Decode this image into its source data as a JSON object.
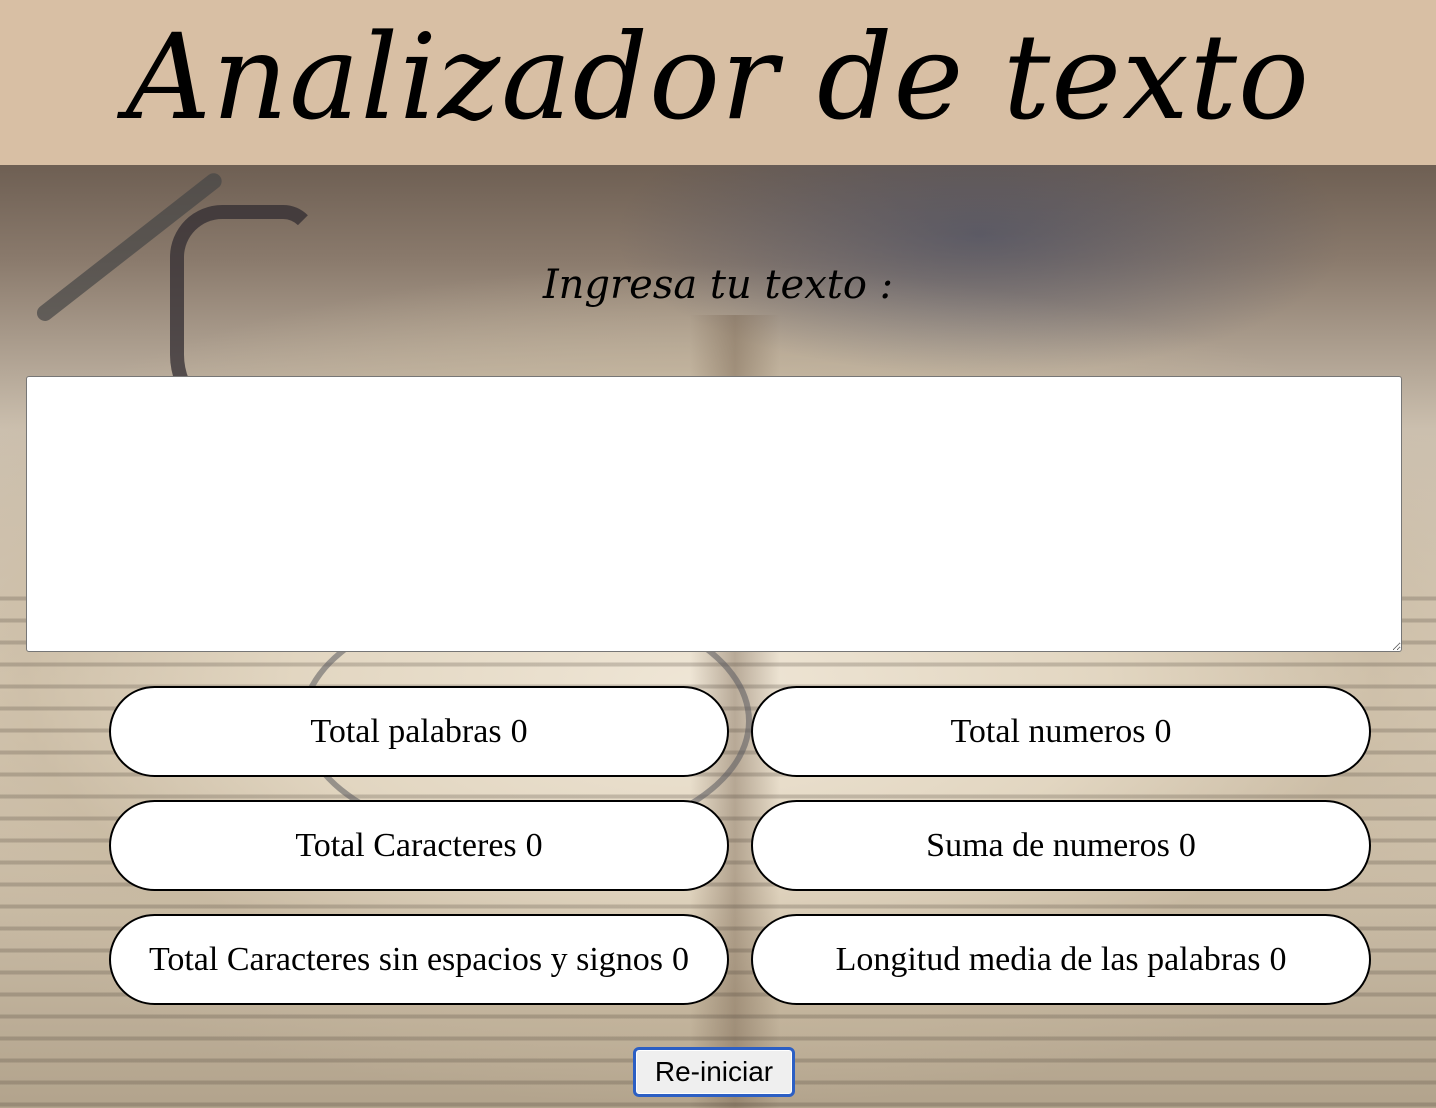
{
  "header": {
    "title": "Analizador de texto",
    "background_color": "#d8bfa4"
  },
  "input": {
    "label": "Ingresa tu texto :",
    "value": "",
    "placeholder": ""
  },
  "stats": {
    "total_palabras": {
      "label": "Total palabras",
      "value": "0"
    },
    "total_numeros": {
      "label": "Total numeros",
      "value": "0"
    },
    "total_caracteres": {
      "label": "Total Caracteres",
      "value": "0"
    },
    "suma_numeros": {
      "label": "Suma de numeros",
      "value": "0"
    },
    "caracteres_sin_espacios": {
      "label": "Total Caracteres sin espacios y signos",
      "value": "0"
    },
    "longitud_media": {
      "label": "Longitud media de las palabras",
      "value": "0"
    }
  },
  "actions": {
    "reset_label": "Re-iniciar",
    "reset_border_color": "#2c5fc4"
  },
  "background": {
    "image": "open-book-with-glasses-photo"
  }
}
